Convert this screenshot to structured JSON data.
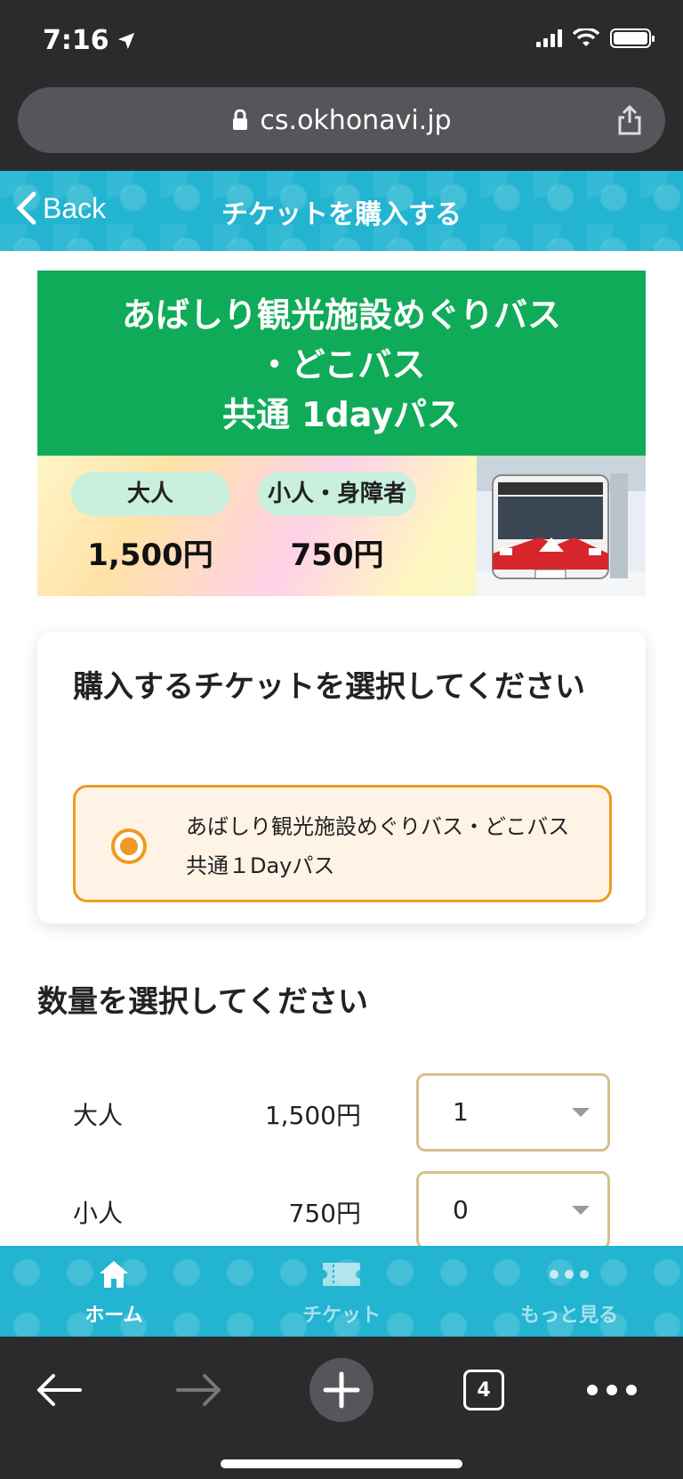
{
  "status_bar": {
    "time": "7:16"
  },
  "browser": {
    "url": "cs.okhonavi.jp",
    "tab_count": "4"
  },
  "header": {
    "back_label": "Back",
    "title": "チケットを購入する"
  },
  "banner": {
    "title_line1": "あばしり観光施設めぐりバス",
    "title_line2": "・どこバス",
    "title_line3": "共通 1dayパス",
    "adult_label": "大人",
    "adult_price": "1,500円",
    "child_label": "小人・身障者",
    "child_price": "750円"
  },
  "ticket_select": {
    "heading": "購入するチケットを選択してください",
    "option_label": "あばしり観光施設めぐりバス・どこバス共通１Dayパス",
    "selected": true
  },
  "quantity": {
    "heading": "数量を選択してください",
    "rows": [
      {
        "name": "大人",
        "price": "1,500円",
        "value": "1"
      },
      {
        "name": "小人",
        "price": "750円",
        "value": "0"
      }
    ]
  },
  "nav": {
    "home": "ホーム",
    "ticket": "チケット",
    "more": "もっと見る"
  },
  "colors": {
    "header_teal": "#22b4d1",
    "banner_green": "#10ab59",
    "accent_orange": "#ef9a23",
    "select_border": "#d6c08c"
  }
}
